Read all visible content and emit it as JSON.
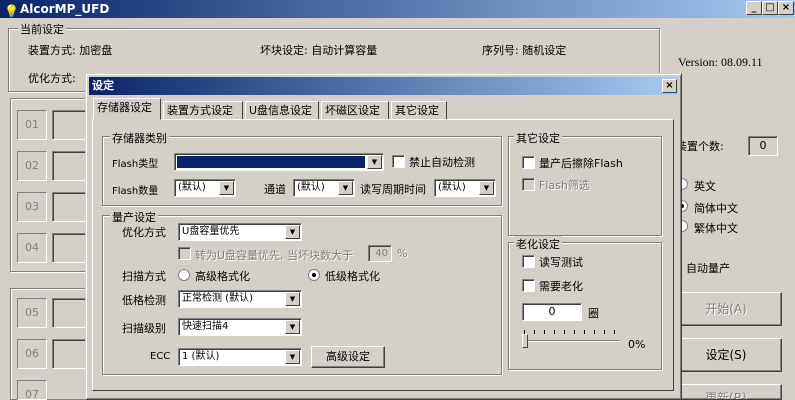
{
  "app": {
    "title": "AlcorMP_UFD"
  },
  "main": {
    "current_settings_label": "当前设定",
    "mode_label": "装置方式: 加密盘",
    "badblock_label": "坏块设定: 自动计算容量",
    "serial_label": "序列号: 随机设定",
    "optimize_label": "优化方式:",
    "version": "Version: 08.09.11",
    "device_count_label": "装置个数:",
    "device_count_value": "0",
    "lang_en": "英文",
    "lang_sc": "简体中文",
    "lang_tc": "繁体中文",
    "auto_produce": "自动量产",
    "start_button": "开始(A)",
    "settings_button": "设定(S)",
    "update_button": "更新(R)",
    "ports": [
      "01",
      "02",
      "03",
      "04",
      "05",
      "06",
      "07"
    ]
  },
  "dialog": {
    "title": "设定",
    "close": "×",
    "tabs": [
      "存储器设定",
      "装置方式设定",
      "U盘信息设定",
      "坏磁区设定",
      "其它设定"
    ],
    "storage": {
      "group_label": "存储器类别",
      "flash_type_label": "Flash类型",
      "flash_type_value": "",
      "disable_auto_detect": "禁止自动检测",
      "flash_count_label": "Flash数量",
      "flash_count_value": "(默认)",
      "channel_label": "通道",
      "channel_value": "(默认)",
      "rw_cycle_label": "读写周期时间",
      "rw_cycle_value": "(默认)"
    },
    "production": {
      "group_label": "量产设定",
      "optimize_label": "优化方式",
      "optimize_value": "U盘容量优先",
      "fallback_label": "转为U盘容量优先, 当坏块数大于",
      "fallback_value": "40",
      "fallback_unit": "%",
      "scan_label": "扫描方式",
      "scan_high": "高级格式化",
      "scan_low": "低级格式化",
      "low_check_label": "低格检测",
      "low_check_value": "正常检测 (默认)",
      "scan_level_label": "扫描级别",
      "scan_level_value": "快速扫描4",
      "ecc_label": "ECC",
      "ecc_value": "1 (默认)",
      "advanced_button": "高级设定"
    },
    "other": {
      "group_label": "其它设定",
      "erase_flash": "量产后擦除Flash",
      "flash_filter": "Flash筛选"
    },
    "aging": {
      "group_label": "老化设定",
      "rw_test": "读写测试",
      "need_aging": "需要老化",
      "cycles_value": "0",
      "cycles_unit": "圈",
      "percent": "0%"
    }
  },
  "colors": {
    "titlebar_start": "#0a246a",
    "titlebar_end": "#a6caf0",
    "face": "#d4d0c8",
    "selection": "#0a246a"
  }
}
